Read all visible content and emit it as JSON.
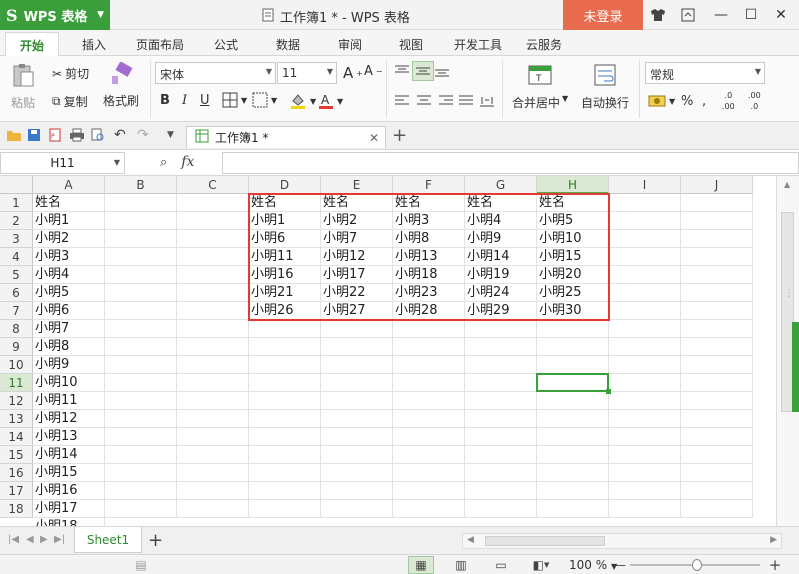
{
  "app": {
    "name": "WPS 表格",
    "logo": "S"
  },
  "window": {
    "title": "工作簿1 * - WPS 表格",
    "login_label": "未登录"
  },
  "menu": {
    "tabs": [
      "开始",
      "插入",
      "页面布局",
      "公式",
      "数据",
      "审阅",
      "视图",
      "开发工具",
      "云服务"
    ],
    "active": "开始"
  },
  "ribbon": {
    "paste": "粘贴",
    "cut": "剪切",
    "copy": "复制",
    "format_painter": "格式刷",
    "font_name": "宋体",
    "font_size": "11",
    "merge_center": "合并居中",
    "wrap_text": "自动换行",
    "number_format": "常规",
    "percent": "%"
  },
  "doc_tab": {
    "label": "工作簿1 *"
  },
  "formula_bar": {
    "name_box": "H11",
    "fx": "fx",
    "value": ""
  },
  "grid": {
    "columns": [
      "A",
      "B",
      "C",
      "D",
      "E",
      "F",
      "G",
      "H",
      "I",
      "J"
    ],
    "rows": [
      "1",
      "2",
      "3",
      "4",
      "5",
      "6",
      "7",
      "8",
      "9",
      "10",
      "11",
      "12",
      "13",
      "14",
      "15",
      "16",
      "17",
      "18"
    ],
    "selected_cell": "H11",
    "col_a": [
      "姓名",
      "小明1",
      "小明2",
      "小明3",
      "小明4",
      "小明5",
      "小明6",
      "小明7",
      "小明8",
      "小明9",
      "小明10",
      "小明11",
      "小明12",
      "小明13",
      "小明14",
      "小明15",
      "小明16",
      "小明17",
      "小明18"
    ],
    "block": [
      [
        "姓名",
        "姓名",
        "姓名",
        "姓名",
        "姓名"
      ],
      [
        "小明1",
        "小明2",
        "小明3",
        "小明4",
        "小明5"
      ],
      [
        "小明6",
        "小明7",
        "小明8",
        "小明9",
        "小明10"
      ],
      [
        "小明11",
        "小明12",
        "小明13",
        "小明14",
        "小明15"
      ],
      [
        "小明16",
        "小明17",
        "小明18",
        "小明19",
        "小明20"
      ],
      [
        "小明21",
        "小明22",
        "小明23",
        "小明24",
        "小明25"
      ],
      [
        "小明26",
        "小明27",
        "小明28",
        "小明29",
        "小明30"
      ]
    ]
  },
  "sheet_tabs": {
    "tabs": [
      "Sheet1"
    ],
    "add": "+"
  },
  "status": {
    "zoom": "100 %",
    "zoom_fraction": 0.5
  },
  "colors": {
    "accent": "#3a9e3a",
    "login": "#e86b4e",
    "highlight": "#e53935"
  }
}
